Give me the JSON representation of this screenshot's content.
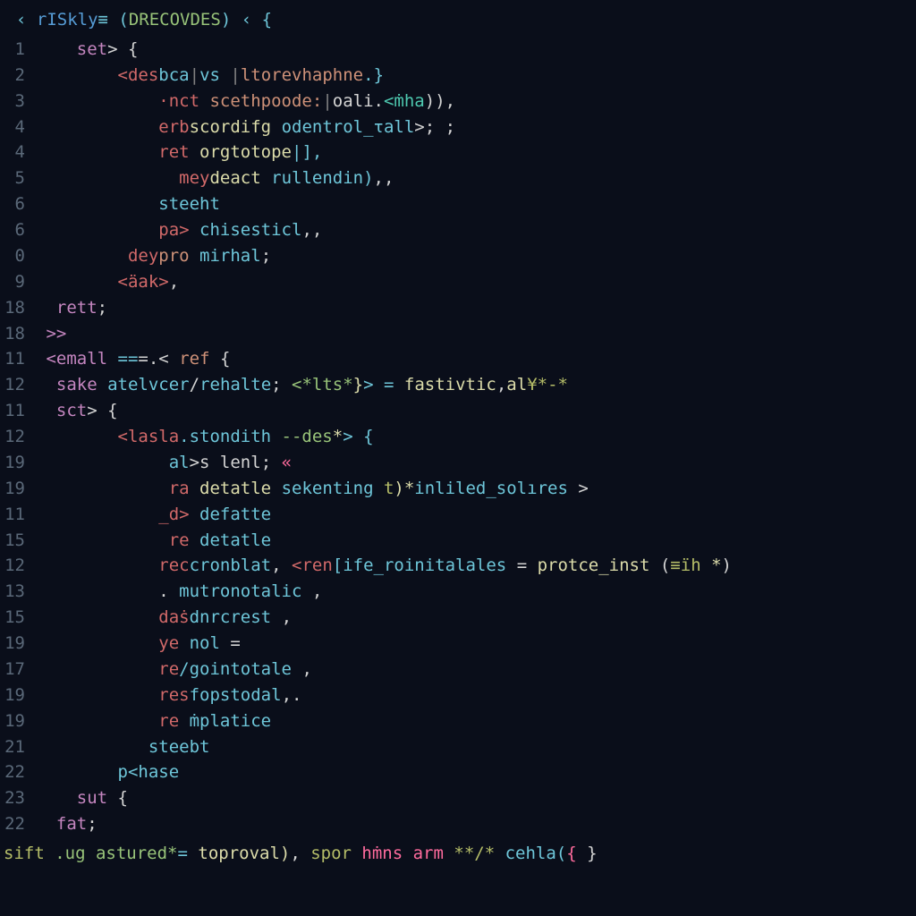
{
  "header": {
    "t1": "‹ ",
    "t2": "rISkly",
    "t3": "≡ (",
    "t4": "DRECOVDES",
    "t5": ") ‹ {"
  },
  "lines": [
    {
      "num": "1",
      "tokens": [
        {
          "t": "    ",
          "c": "c-white"
        },
        {
          "t": "set",
          "c": "c-purple"
        },
        {
          "t": "> {",
          "c": "c-white"
        }
      ]
    },
    {
      "num": "2",
      "tokens": [
        {
          "t": "        ",
          "c": "c-white"
        },
        {
          "t": "<des",
          "c": "c-red"
        },
        {
          "t": "bca",
          "c": "c-cyan"
        },
        {
          "t": "|",
          "c": "c-gray"
        },
        {
          "t": "vs ",
          "c": "c-cyan"
        },
        {
          "t": "|",
          "c": "c-gray"
        },
        {
          "t": "ltorevhaphne",
          "c": "c-orange"
        },
        {
          "t": ".}",
          "c": "c-cyan"
        }
      ]
    },
    {
      "num": "3",
      "tokens": [
        {
          "t": "            ",
          "c": "c-white"
        },
        {
          "t": "·nct ",
          "c": "c-red"
        },
        {
          "t": "scethpoode:",
          "c": "c-orange"
        },
        {
          "t": "|",
          "c": "c-gray"
        },
        {
          "t": "oali.",
          "c": "c-white"
        },
        {
          "t": "<ṁha",
          "c": "c-teal"
        },
        {
          "t": ")),",
          "c": "c-white"
        }
      ]
    },
    {
      "num": "4",
      "tokens": [
        {
          "t": "            ",
          "c": "c-white"
        },
        {
          "t": "erb",
          "c": "c-red"
        },
        {
          "t": "scordifg ",
          "c": "c-yellow"
        },
        {
          "t": "odentrol_τall",
          "c": "c-cyan"
        },
        {
          "t": ">; ;",
          "c": "c-white"
        }
      ]
    },
    {
      "num": "4",
      "tokens": [
        {
          "t": "            ",
          "c": "c-white"
        },
        {
          "t": "ret ",
          "c": "c-red"
        },
        {
          "t": "orgtotope",
          "c": "c-yellow"
        },
        {
          "t": "|],",
          "c": "c-cyan"
        }
      ]
    },
    {
      "num": "5",
      "tokens": [
        {
          "t": "              ",
          "c": "c-white"
        },
        {
          "t": "mey",
          "c": "c-red"
        },
        {
          "t": "deact ",
          "c": "c-yellow"
        },
        {
          "t": "rullendin)",
          "c": "c-cyan"
        },
        {
          "t": ",,",
          "c": "c-white"
        }
      ]
    },
    {
      "num": "6",
      "tokens": [
        {
          "t": "            ",
          "c": "c-white"
        },
        {
          "t": "steeht",
          "c": "c-cyan"
        }
      ]
    },
    {
      "num": "6",
      "tokens": [
        {
          "t": "            ",
          "c": "c-white"
        },
        {
          "t": "pa> ",
          "c": "c-red"
        },
        {
          "t": "chisesticl",
          "c": "c-cyan"
        },
        {
          "t": ",,",
          "c": "c-white"
        }
      ]
    },
    {
      "num": "0",
      "tokens": [
        {
          "t": "         ",
          "c": "c-white"
        },
        {
          "t": "dey",
          "c": "c-red"
        },
        {
          "t": "pro ",
          "c": "c-orange"
        },
        {
          "t": "mirhal",
          "c": "c-cyan"
        },
        {
          "t": ";",
          "c": "c-white"
        }
      ]
    },
    {
      "num": "9",
      "tokens": [
        {
          "t": "        ",
          "c": "c-white"
        },
        {
          "t": "<äak>",
          "c": "c-red"
        },
        {
          "t": ",",
          "c": "c-white"
        }
      ]
    },
    {
      "num": "18",
      "tokens": [
        {
          "t": "  ",
          "c": "c-white"
        },
        {
          "t": "rett",
          "c": "c-purple"
        },
        {
          "t": ";",
          "c": "c-white"
        }
      ]
    },
    {
      "num": "18",
      "tokens": [
        {
          "t": " ",
          "c": "c-white"
        },
        {
          "t": ">>",
          "c": "c-purple"
        }
      ]
    },
    {
      "num": "",
      "tokens": []
    },
    {
      "num": "11",
      "tokens": [
        {
          "t": " ",
          "c": "c-white"
        },
        {
          "t": "<emall ",
          "c": "c-purple"
        },
        {
          "t": "==",
          "c": "c-cyan"
        },
        {
          "t": "=.< ",
          "c": "c-white"
        },
        {
          "t": "ref ",
          "c": "c-orange"
        },
        {
          "t": "{",
          "c": "c-white"
        }
      ]
    },
    {
      "num": "12",
      "tokens": [
        {
          "t": "  ",
          "c": "c-white"
        },
        {
          "t": "sake ",
          "c": "c-purple"
        },
        {
          "t": "atelvcer",
          "c": "c-cyan"
        },
        {
          "t": "/",
          "c": "c-white"
        },
        {
          "t": "rehalte",
          "c": "c-cyan"
        },
        {
          "t": "; ",
          "c": "c-white"
        },
        {
          "t": "<*lts*",
          "c": "c-green"
        },
        {
          "t": "}",
          "c": "c-yellow"
        },
        {
          "t": "> = ",
          "c": "c-cyan"
        },
        {
          "t": "fastivtic",
          "c": "c-yellow"
        },
        {
          "t": ",",
          "c": "c-white"
        },
        {
          "t": "al",
          "c": "c-yellow"
        },
        {
          "t": "¥*-*",
          "c": "c-olive"
        }
      ]
    },
    {
      "num": "11",
      "tokens": [
        {
          "t": "  ",
          "c": "c-white"
        },
        {
          "t": "sct",
          "c": "c-purple"
        },
        {
          "t": "> {",
          "c": "c-white"
        }
      ]
    },
    {
      "num": "12",
      "tokens": [
        {
          "t": "        ",
          "c": "c-white"
        },
        {
          "t": "<lasla",
          "c": "c-red"
        },
        {
          "t": ".stondith ",
          "c": "c-cyan"
        },
        {
          "t": "--des",
          "c": "c-green"
        },
        {
          "t": "*",
          "c": "c-yellow"
        },
        {
          "t": "> {",
          "c": "c-cyan"
        }
      ]
    },
    {
      "num": "19",
      "tokens": [
        {
          "t": "             ",
          "c": "c-white"
        },
        {
          "t": "al",
          "c": "c-cyan"
        },
        {
          "t": ">s lenl",
          "c": "c-white"
        },
        {
          "t": "; ",
          "c": "c-white"
        },
        {
          "t": "«",
          "c": "c-pink"
        }
      ]
    },
    {
      "num": "19",
      "tokens": [
        {
          "t": "             ",
          "c": "c-white"
        },
        {
          "t": "ra ",
          "c": "c-red"
        },
        {
          "t": "detatle ",
          "c": "c-yellow"
        },
        {
          "t": "sekenting ",
          "c": "c-cyan"
        },
        {
          "t": "t",
          "c": "c-olive"
        },
        {
          "t": ")*",
          "c": "c-yellow"
        },
        {
          "t": "inliled_solıres ",
          "c": "c-cyan"
        },
        {
          "t": ">",
          "c": "c-white"
        }
      ]
    },
    {
      "num": "11",
      "tokens": [
        {
          "t": "            ",
          "c": "c-white"
        },
        {
          "t": "_d> ",
          "c": "c-red"
        },
        {
          "t": "defatte",
          "c": "c-cyan"
        }
      ]
    },
    {
      "num": "15",
      "tokens": [
        {
          "t": "             ",
          "c": "c-white"
        },
        {
          "t": "re ",
          "c": "c-red"
        },
        {
          "t": "detatle",
          "c": "c-cyan"
        }
      ]
    },
    {
      "num": "12",
      "tokens": [
        {
          "t": "            ",
          "c": "c-white"
        },
        {
          "t": "rec",
          "c": "c-red"
        },
        {
          "t": "cronblat",
          "c": "c-cyan"
        },
        {
          "t": ", ",
          "c": "c-white"
        },
        {
          "t": "<ren",
          "c": "c-red"
        },
        {
          "t": "[ife_roinitalales ",
          "c": "c-cyan"
        },
        {
          "t": "= ",
          "c": "c-white"
        },
        {
          "t": "protce_inst ",
          "c": "c-yellow"
        },
        {
          "t": "(",
          "c": "c-white"
        },
        {
          "t": "≡ïh ",
          "c": "c-olive"
        },
        {
          "t": "*",
          "c": "c-yellow"
        },
        {
          "t": ")",
          "c": "c-white"
        }
      ]
    },
    {
      "num": "13",
      "tokens": [
        {
          "t": "            ",
          "c": "c-white"
        },
        {
          "t": ". ",
          "c": "c-white"
        },
        {
          "t": "mutronotalic ",
          "c": "c-cyan"
        },
        {
          "t": ",",
          "c": "c-white"
        }
      ]
    },
    {
      "num": "15",
      "tokens": [
        {
          "t": "            ",
          "c": "c-white"
        },
        {
          "t": "das",
          "c": "c-red"
        },
        {
          "t": "̇dnrcrest ",
          "c": "c-cyan"
        },
        {
          "t": ",",
          "c": "c-white"
        }
      ]
    },
    {
      "num": "19",
      "tokens": [
        {
          "t": "            ",
          "c": "c-white"
        },
        {
          "t": "ye ",
          "c": "c-red"
        },
        {
          "t": "nol ",
          "c": "c-cyan"
        },
        {
          "t": "=",
          "c": "c-white"
        }
      ]
    },
    {
      "num": "17",
      "tokens": [
        {
          "t": "            ",
          "c": "c-white"
        },
        {
          "t": "re",
          "c": "c-red"
        },
        {
          "t": "/gointotale ",
          "c": "c-cyan"
        },
        {
          "t": ",",
          "c": "c-white"
        }
      ]
    },
    {
      "num": "19",
      "tokens": [
        {
          "t": "            ",
          "c": "c-white"
        },
        {
          "t": "res",
          "c": "c-red"
        },
        {
          "t": "fopstodal",
          "c": "c-cyan"
        },
        {
          "t": ",.",
          "c": "c-white"
        }
      ]
    },
    {
      "num": "19",
      "tokens": [
        {
          "t": "            ",
          "c": "c-white"
        },
        {
          "t": "re ",
          "c": "c-red"
        },
        {
          "t": "ṁplatice",
          "c": "c-cyan"
        }
      ]
    },
    {
      "num": "21",
      "tokens": [
        {
          "t": "           ",
          "c": "c-white"
        },
        {
          "t": "steebt",
          "c": "c-cyan"
        }
      ]
    },
    {
      "num": "22",
      "tokens": [
        {
          "t": "        ",
          "c": "c-white"
        },
        {
          "t": "p<hase",
          "c": "c-cyan"
        }
      ]
    },
    {
      "num": "23",
      "tokens": [
        {
          "t": "    ",
          "c": "c-white"
        },
        {
          "t": "sut ",
          "c": "c-purple"
        },
        {
          "t": "{",
          "c": "c-white"
        }
      ]
    },
    {
      "num": "22",
      "tokens": [
        {
          "t": "  ",
          "c": "c-white"
        },
        {
          "t": "fat",
          "c": "c-purple"
        },
        {
          "t": ";",
          "c": "c-white"
        }
      ]
    }
  ],
  "footer": {
    "t1": "sift ",
    "t2": ".ug astured*",
    "t3": "= ",
    "t4": "toproval)",
    "t5": ", ",
    "t6": "spor ",
    "t7": "hṁns arm ",
    "t8": "**/*",
    "t9": " cehla(",
    "t10": "{",
    "t11": "                            }"
  }
}
